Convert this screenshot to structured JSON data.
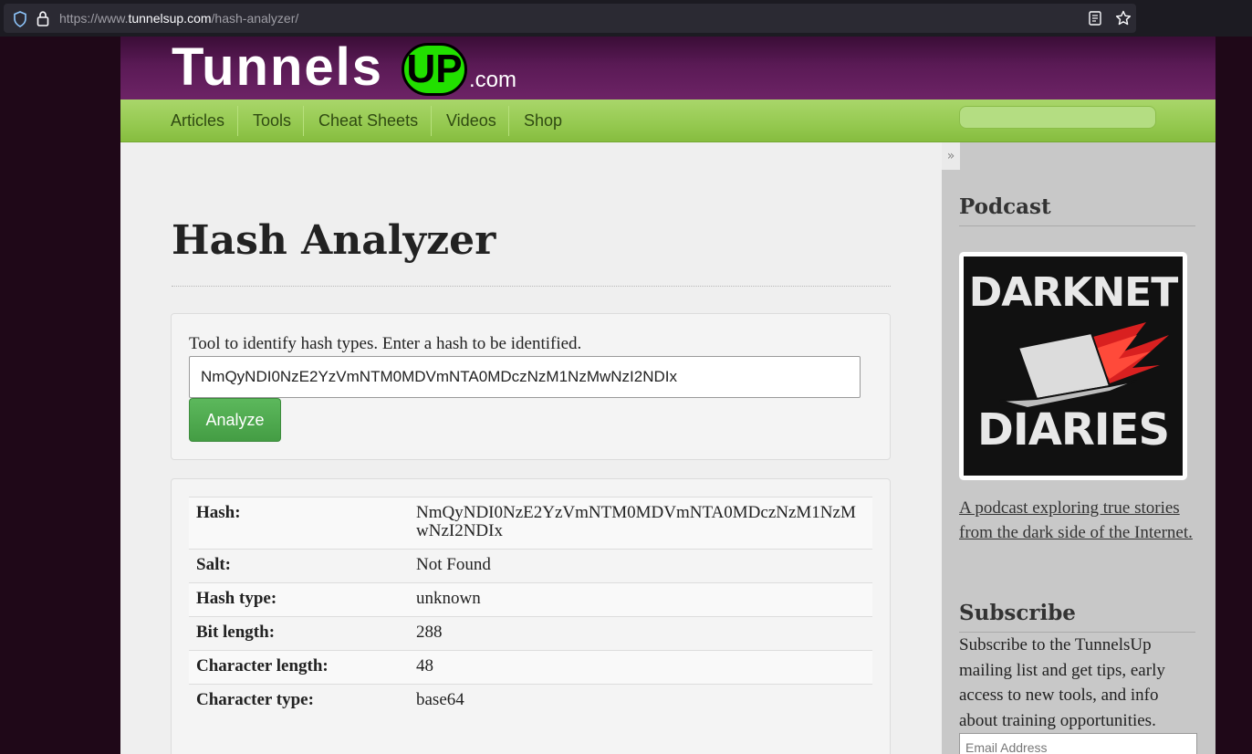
{
  "browser": {
    "url_prefix": "https://www.",
    "url_domain": "tunnelsup.com",
    "url_path": "/hash-analyzer/"
  },
  "header": {
    "logo_main": "Tunnels",
    "logo_up": "UP",
    "logo_tld": ".com"
  },
  "nav": {
    "items": [
      "Articles",
      "Tools",
      "Cheat Sheets",
      "Videos",
      "Shop"
    ],
    "sidebar_toggle": "»"
  },
  "main": {
    "title": "Hash Analyzer",
    "description": "Tool to identify hash types. Enter a hash to be identified.",
    "hash_input_value": "NmQyNDI0NzE2YzVmNTM0MDVmNTA0MDczNzM1NzMwNzI2NDIx",
    "analyze_label": "Analyze",
    "results": [
      {
        "label": "Hash:",
        "value": "NmQyNDI0NzE2YzVmNTM0MDVmNTA0MDczNzM1NzMwNzI2NDIx"
      },
      {
        "label": "Salt:",
        "value": "Not Found"
      },
      {
        "label": "Hash type:",
        "value": "unknown"
      },
      {
        "label": "Bit length:",
        "value": "288"
      },
      {
        "label": "Character length:",
        "value": "48"
      },
      {
        "label": "Character type:",
        "value": "base64"
      }
    ]
  },
  "sidebar": {
    "podcast_heading": "Podcast",
    "podcast_art_line1": "DARKNET",
    "podcast_art_line2": "DIARIES",
    "podcast_link": "A podcast exploring true stories from the dark side of the Internet.",
    "subscribe_heading": "Subscribe",
    "subscribe_text": "Subscribe to the TunnelsUp mailing list and get tips, early access to new tools, and info about training opportunities.",
    "email_placeholder": "Email Address"
  },
  "colors": {
    "header_purple": "#5a1a55",
    "nav_green": "#95c950",
    "logo_up_green": "#22e000",
    "analyze_button": "#5cb85c"
  }
}
